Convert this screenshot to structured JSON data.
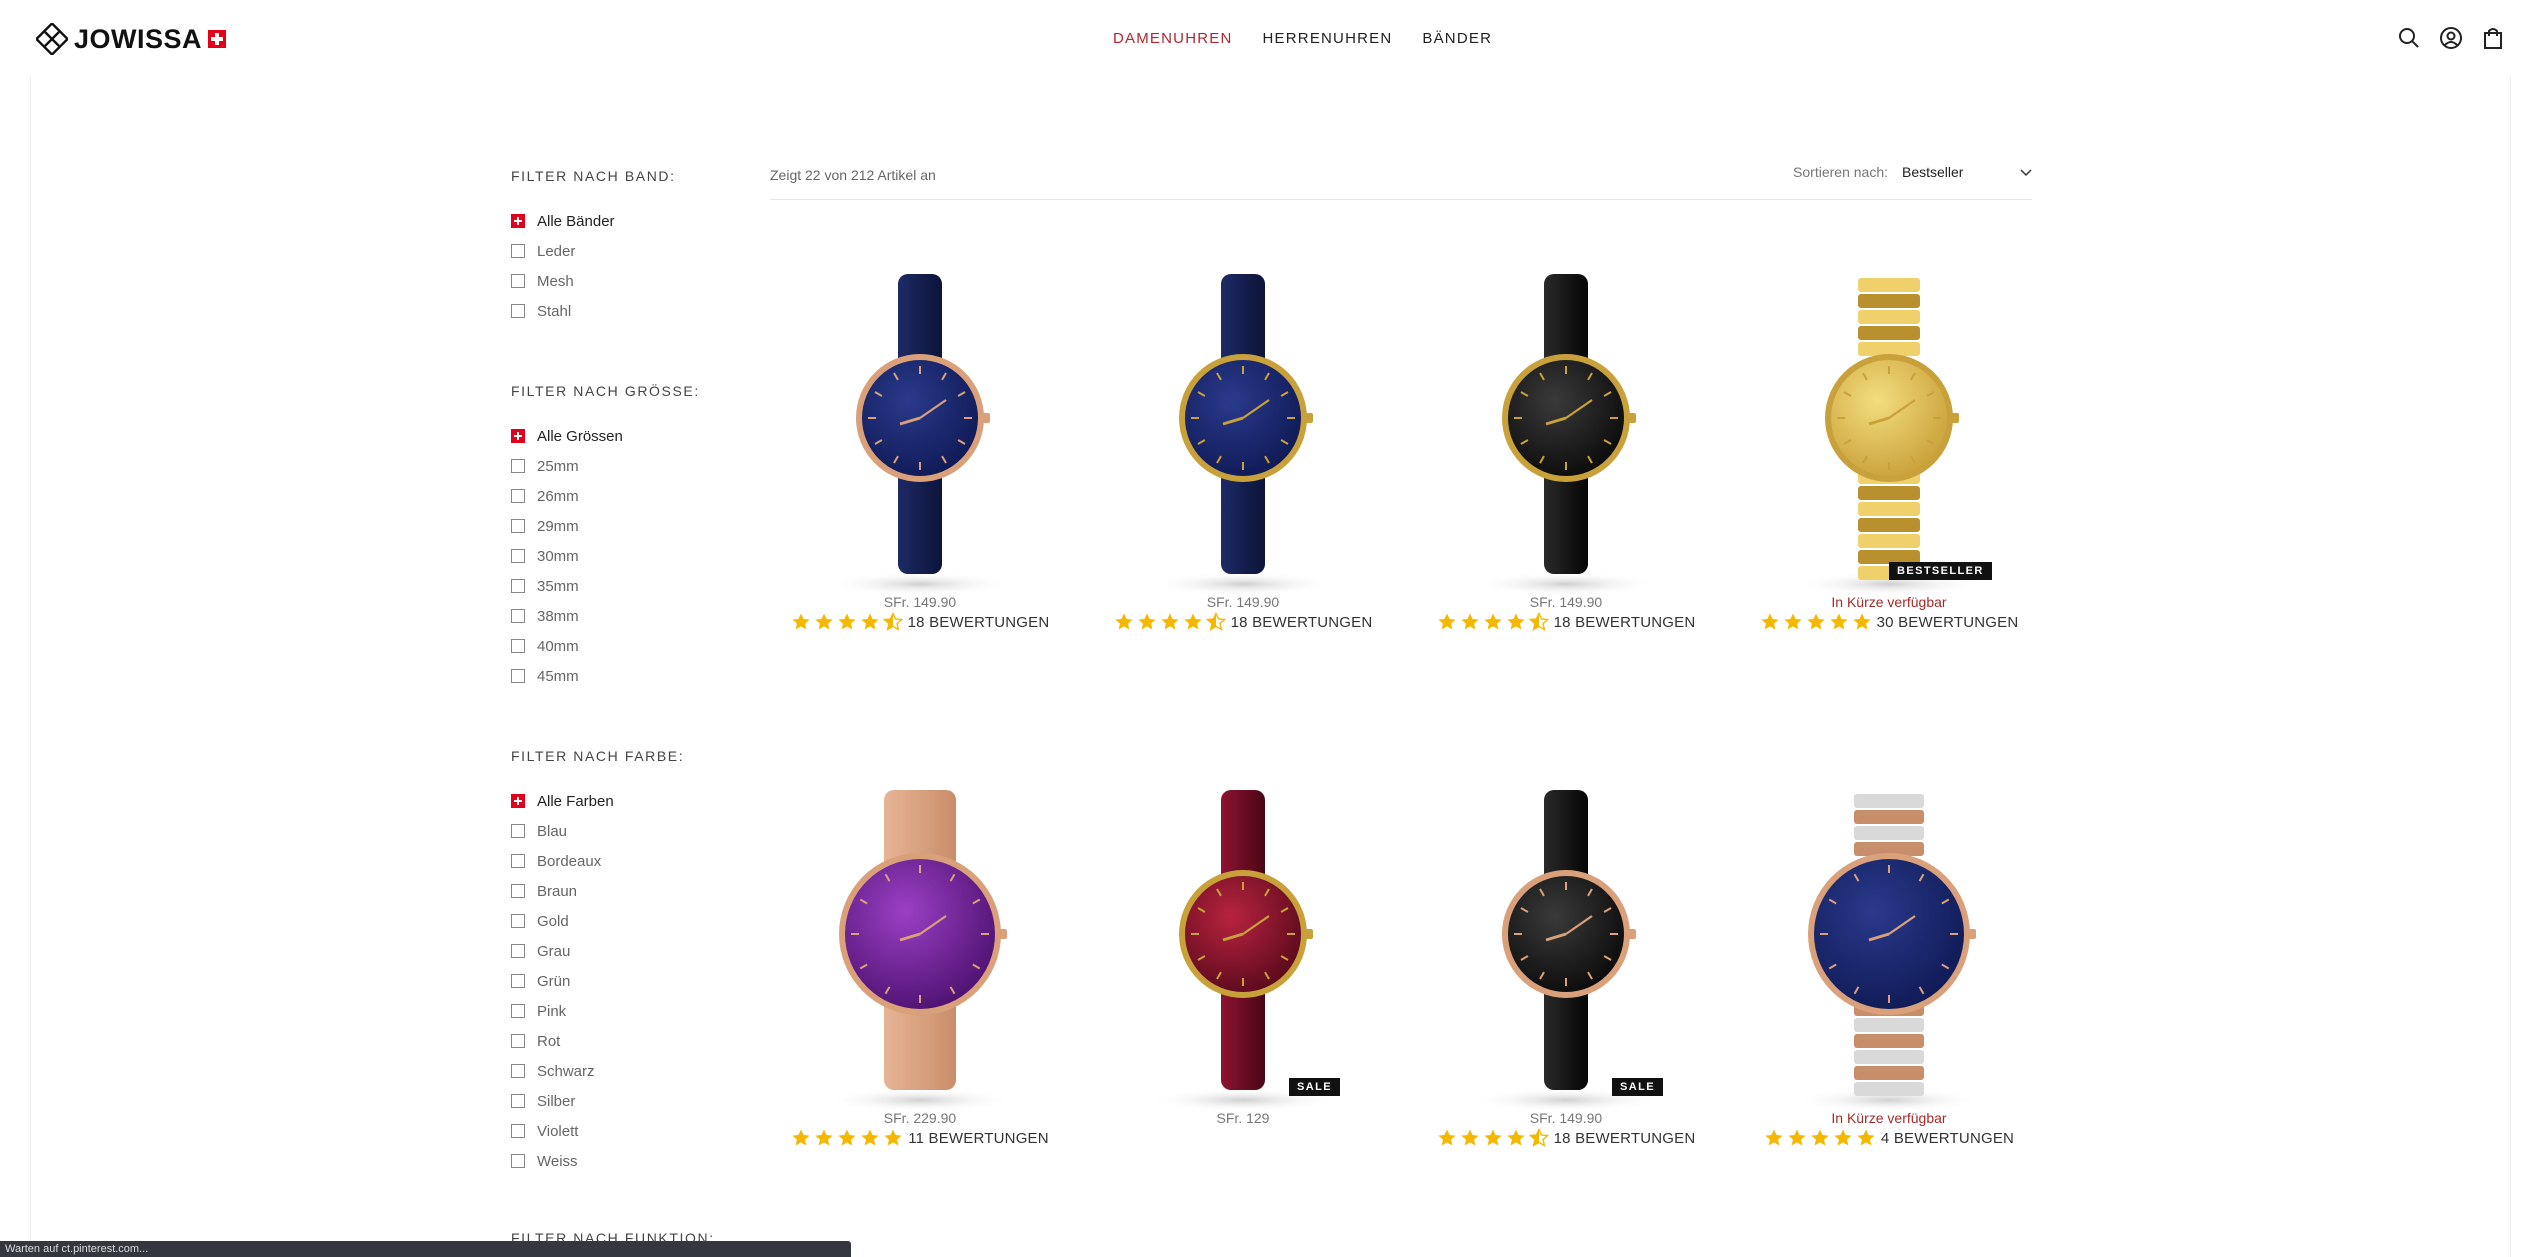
{
  "brand": {
    "name": "JOWISSA",
    "accent_color": "#e2001a"
  },
  "nav": {
    "items": [
      {
        "label": "DAMENUHREN",
        "active": true
      },
      {
        "label": "HERRENUHREN",
        "active": false
      },
      {
        "label": "BÄNDER",
        "active": false
      }
    ]
  },
  "header_icons": [
    "search-icon",
    "account-icon",
    "cart-icon"
  ],
  "filters": {
    "band": {
      "title": "FILTER NACH BAND:",
      "options": [
        "Alle Bänder",
        "Leder",
        "Mesh",
        "Stahl"
      ],
      "selected": "Alle Bänder"
    },
    "size": {
      "title": "FILTER NACH GRÖSSE:",
      "options": [
        "Alle Grössen",
        "25mm",
        "26mm",
        "29mm",
        "30mm",
        "35mm",
        "38mm",
        "40mm",
        "45mm"
      ],
      "selected": "Alle Grössen"
    },
    "color": {
      "title": "FILTER NACH FARBE:",
      "options": [
        "Alle Farben",
        "Blau",
        "Bordeaux",
        "Braun",
        "Gold",
        "Grau",
        "Grün",
        "Pink",
        "Rot",
        "Schwarz",
        "Silber",
        "Violett",
        "Weiss"
      ],
      "selected": "Alle Farben"
    },
    "function_title_partial": "FILTER NACH FUNKTION:"
  },
  "toolbar": {
    "result_count": "Zeigt 22 von 212 Artikel an",
    "sort_label": "Sortieren nach:",
    "sort_value": "Bestseller"
  },
  "products": [
    {
      "price": "SFr. 149.90",
      "rating": 4.5,
      "reviews": "18 BEWERTUNGEN",
      "badge": "",
      "strap": "navy-leather",
      "dial": "navy",
      "case": "rose"
    },
    {
      "price": "SFr. 149.90",
      "rating": 4.5,
      "reviews": "18 BEWERTUNGEN",
      "badge": "",
      "strap": "navy-leather",
      "dial": "navy",
      "case": "gold"
    },
    {
      "price": "SFr. 149.90",
      "rating": 4.5,
      "reviews": "18 BEWERTUNGEN",
      "badge": "",
      "strap": "black-leather",
      "dial": "black",
      "case": "gold"
    },
    {
      "price": "In Kürze verfügbar",
      "rating": 5,
      "reviews": "30 BEWERTUNGEN",
      "badge": "BESTSELLER",
      "strap": "gold-bracelet",
      "dial": "gold",
      "case": "gold"
    },
    {
      "price": "SFr. 229.90",
      "rating": 5,
      "reviews": "11 BEWERTUNGEN",
      "badge": "",
      "strap": "rose-mesh",
      "dial": "violet",
      "case": "rose"
    },
    {
      "price": "SFr. 129",
      "rating": 0,
      "reviews": "",
      "badge": "SALE",
      "strap": "bordeaux-leather",
      "dial": "bordeaux",
      "case": "gold"
    },
    {
      "price": "SFr. 149.90",
      "rating": 4.5,
      "reviews": "18 BEWERTUNGEN",
      "badge": "SALE",
      "strap": "black-leather",
      "dial": "black",
      "case": "rose"
    },
    {
      "price": "In Kürze verfügbar",
      "rating": 5,
      "reviews": "4 BEWERTUNGEN",
      "badge": "",
      "strap": "bicolor-bracelet",
      "dial": "navy",
      "case": "rose"
    }
  ],
  "colors": {
    "nav_active": "#b3262e",
    "star": "#f5b800",
    "soon_text": "#a52a2a",
    "badge_bg": "#111111"
  },
  "statusbar": {
    "text": "Warten auf ct.pinterest.com..."
  }
}
